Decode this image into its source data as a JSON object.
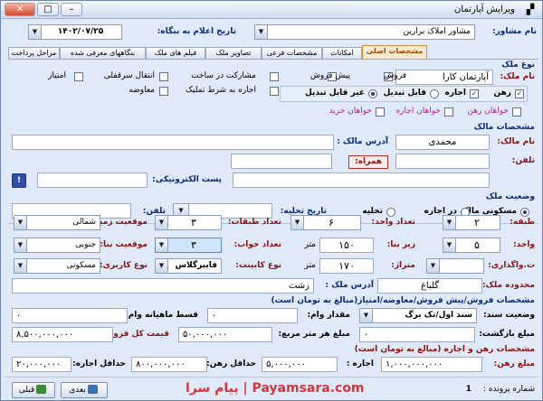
{
  "window": {
    "title": "ویرایش آپارتمان",
    "buttons": {
      "close": "✕",
      "max": "□",
      "min": "–"
    }
  },
  "header": {
    "agent_label": "نام مشاور:",
    "agent_value": "مشاور املاک برارین",
    "date_label": "تاریخ اعلام به بنگاه:",
    "date_value": "۱۴۰۲/۰۷/۲۵"
  },
  "tabs": [
    "مراحل پرداخت",
    "بنگاههای معرفی شده",
    "فیلم های ملک",
    "تصاویر ملک",
    "مشخصات فرعی",
    "امکانات",
    "مشخصات اصلی"
  ],
  "active_tab": "مشخصات اصلی",
  "property_type": {
    "section": "نوع ملک",
    "name_label": "نام ملک:",
    "name_value": "آپارتمان کارا",
    "checks": [
      {
        "label": "فروش",
        "checked": true
      },
      {
        "label": "پیش فروش",
        "checked": false
      },
      {
        "label": "مشارکت در ساخت",
        "checked": false
      },
      {
        "label": "انتقال سرقفلی",
        "checked": false
      },
      {
        "label": "امتیاز",
        "checked": false
      },
      {
        "label": "اجاره به شرط تملیک",
        "checked": false
      },
      {
        "label": "معاوضه",
        "checked": false
      }
    ],
    "rent_options": [
      {
        "label": "رهن",
        "checked": true
      },
      {
        "label": "اجاره",
        "checked": true
      }
    ],
    "convertible": [
      {
        "label": "قابل تبدیل",
        "selected": false
      },
      {
        "label": "غیر قابل تبدیل",
        "selected": true
      }
    ],
    "wants": [
      {
        "label": "خواهان رهن",
        "checked": false
      },
      {
        "label": "خواهان اجاره",
        "checked": false
      },
      {
        "label": "خواهان خرید",
        "checked": false
      }
    ]
  },
  "owner": {
    "section": "مشخصات مالک",
    "name_label": "نام مالک:",
    "name_value": "محمدی",
    "address_label": "آدرس مالک :",
    "address_value": "",
    "phone_label": "تلفن:",
    "phone_value": "",
    "mobile_label": "همراه:",
    "mobile_value": "",
    "email_label": "پست الکترونیکی:",
    "email_value": ""
  },
  "status": {
    "section": "وضعیت ملک",
    "options": [
      {
        "label": "مسکونی مالک",
        "selected": true
      },
      {
        "label": "در اجاره",
        "selected": false
      },
      {
        "label": "تخلیه",
        "selected": false
      }
    ],
    "evac_date_label": "تاریخ تخلیه:",
    "evac_date_value": "",
    "phone_label": "تلفن:",
    "phone_value": ""
  },
  "specs": {
    "floor_label": "طبقه:",
    "floor_value": "۲",
    "floors_total_label": "تعداد طبقات:",
    "floors_total_value": "۳",
    "land_pos_label": "موقعیت زمین:",
    "land_pos_value": "شمالی",
    "unit_label": "واحد:",
    "unit_value": "۵",
    "units_count_label": "تعداد واحد:",
    "units_count_value": "۶",
    "area_label": "زیر بنا:",
    "area_value": "۱۵۰",
    "area_unit": "متر",
    "bedrooms_label": "تعداد خواب:",
    "bedrooms_value": "۳",
    "building_pos_label": "موقعیت بنا:",
    "building_pos_value": "جنوبی",
    "transfer_label": "ت.واگذاری:",
    "transfer_value": "",
    "meterage_label": "متراژ:",
    "meterage_value": "۱۷۰",
    "meterage_unit": "متر",
    "cabinet_label": "نوع کابینت:",
    "cabinet_value": "فایبرگلاس",
    "usage_label": "نوع کاربری:",
    "usage_value": "مسکونی",
    "region_label": "محدوده ملک:",
    "region_value": "گلباغ",
    "prop_address_label": "آدرس ملک :",
    "prop_address_value": "زشت"
  },
  "sale": {
    "section": "مشخصات فروش/پیش فروش/معاوضه/امتیاز(مبالغ به تومان است)",
    "doc_label": "وضعیت سند:",
    "doc_value": "سند اول/تک برگ",
    "loan_label": "مقدار وام:",
    "loan_value": "۰",
    "installment_label": "قسط ماهیانه وام:",
    "installment_value": "۰",
    "deposit_label": "مبلغ بازگشت:",
    "deposit_value": "۰",
    "per_meter_label": "مبلغ هر متر مربع:",
    "per_meter_value": "۵۰,۰۰۰,۰۰۰",
    "total_label": "قیمت کل فروش:",
    "total_value": "۸,۵۰۰,۰۰۰,۰۰۰"
  },
  "rent": {
    "section": "مشخصات رهن و اجاره (مبالغ به تومان است)",
    "mortgage_label": "مبلغ رهن:",
    "mortgage_value": "۱,۰۰۰,۰۰۰,۰۰۰",
    "rent_label": "اجاره :",
    "rent_value": "۵,۰۰۰,۰۰۰",
    "min_mortgage_label": "حداقل رهن:",
    "min_mortgage_value": "۸۰۰,۰۰۰,۰۰۰",
    "min_rent_label": "حداقل اجاره:",
    "min_rent_value": "۲۰,۰۰۰,۰۰۰"
  },
  "footer": {
    "file_no_label": "شماره پرونده :",
    "file_no_value": "1",
    "prev_label": "قبلی",
    "next_label": "بعدی",
    "watermark": "پیام سرا | Payamsara.com"
  },
  "colors": {
    "accent": "#c88e42",
    "panel": "#dfe9f7",
    "label_blue": "#0d2a7a",
    "label_maroon": "#8a1414"
  }
}
